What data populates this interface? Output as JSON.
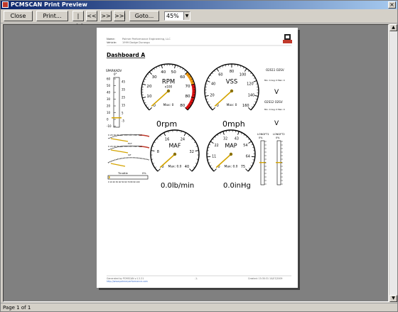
{
  "window": {
    "title": "PCMSCAN Print Preview",
    "close_glyph": "×"
  },
  "toolbar": {
    "close_label": "Close",
    "print_label": "Print...",
    "first_label": "|<<",
    "prev_label": "<<",
    "next_label": ">>",
    "last_label": ">>|",
    "goto_label": "Goto...",
    "zoom_value": "45%"
  },
  "status": {
    "page_text": "Page 1 of 1"
  },
  "report": {
    "name_label": "Name:",
    "name_value": "Palmer Performance Engineering, LLC",
    "vehicle_label": "Vehicle:",
    "vehicle_value": "1999 Dodge Durango",
    "section_title": "Dashboard A",
    "footer_generated": "Generated by PCMSCAN v.1.2.21",
    "footer_url": "http://www.palmerperformance.com",
    "footer_page": "-1-",
    "footer_created": "Created: 15:30:31 10/07/2009"
  },
  "gauges": {
    "rpm": {
      "name": "RPM",
      "sub": "x100",
      "max_text": "Max: 0",
      "reading": "0rpm",
      "ticks": [
        "0",
        "10",
        "20",
        "30",
        "40",
        "50",
        "60",
        "70",
        "80",
        "80"
      ]
    },
    "vss": {
      "name": "VSS",
      "max_text": "Max: 0",
      "reading": "0mph",
      "ticks": [
        "0",
        "20",
        "40",
        "60",
        "80",
        "100",
        "120",
        "140",
        "160"
      ]
    },
    "maf": {
      "name": "MAF",
      "max_text": "Max: 0.0",
      "reading": "0.0lb/min",
      "ticks": [
        "0",
        "8",
        "16",
        "24",
        "32",
        "40"
      ]
    },
    "map": {
      "name": "MAP",
      "max_text": "Max: 0.0",
      "reading": "0.0inHg",
      "ticks": [
        "0",
        "11",
        "22",
        "32",
        "43",
        "54",
        "64",
        "75"
      ]
    }
  },
  "o2": {
    "label_1": "O2S11 O2SV",
    "label_2": "O2S12 O2SV",
    "unit_1": "V",
    "unit_2": "V",
    "minmax_1": "Min: 0  Avg: 0  Max: 0",
    "minmax_2": "Min: 0  Avg: 0  Max: 0"
  },
  "spark": {
    "title": "SPARKADV",
    "unit": "0°",
    "ticks": [
      "60",
      "50",
      "40",
      "30",
      "20",
      "10",
      "0",
      "-10"
    ],
    "right_ticks": [
      "45",
      "35",
      "25",
      "15",
      "5",
      "-5"
    ]
  },
  "fuel_trim": {
    "label_1": "LONGFT1",
    "label_2": "LONGFT2",
    "pct_1": "0%",
    "pct_2": "0%"
  },
  "small": {
    "ect_label": "ECT",
    "iat_label": "IAT",
    "throttle_label": "Throttle",
    "throttle_pct": "0%",
    "scale_text": "0 10 20 30 40 50 60 70 80 90 100"
  }
}
